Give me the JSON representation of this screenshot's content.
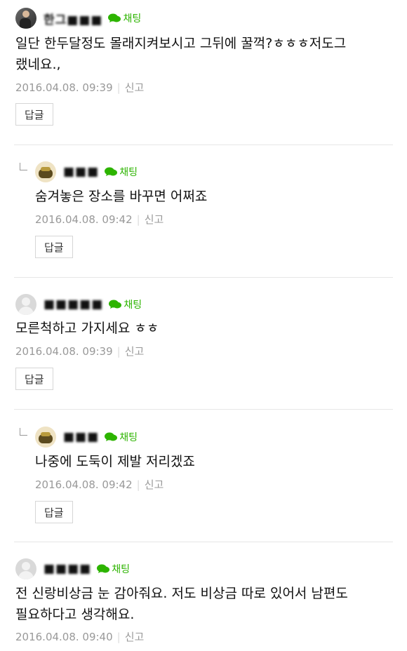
{
  "chat_label": "채팅",
  "report_label": "신고",
  "reply_label": "답글",
  "comments": [
    {
      "nickname": "한그■■■",
      "text_line1": "일단 한두달정도 몰래지켜보시고 그뒤에 꿀꺽?ㅎㅎㅎ저도그",
      "text_line2": "랬네요.,",
      "date": "2016.04.08. 09:39"
    },
    {
      "nickname": "■■■",
      "text_line1": "숨겨놓은 장소를 바꾸면 어쩌죠",
      "date": "2016.04.08. 09:42"
    },
    {
      "nickname": "■■■■■",
      "text_line1": "모른척하고 가지세요 ㅎㅎ",
      "date": "2016.04.08. 09:39"
    },
    {
      "nickname": "■■■",
      "text_line1": "나중에 도둑이 제발 저리겠죠",
      "date": "2016.04.08. 09:42"
    },
    {
      "nickname": "■■■■",
      "text_line1": "전 신랑비상금 눈 감아줘요. 저도 비상금 따로 있어서 남편도",
      "text_line2": "필요하다고 생각해요.",
      "date": "2016.04.08. 09:40"
    }
  ],
  "colors": {
    "chat_green": "#2db400",
    "meta_grey": "#999999"
  }
}
